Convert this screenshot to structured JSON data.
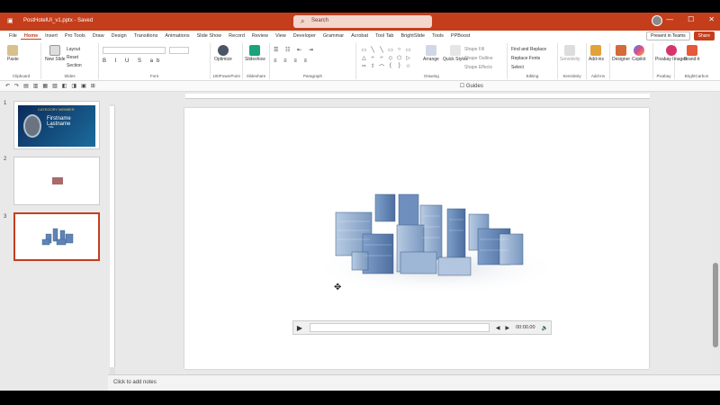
{
  "titlebar": {
    "doc_title": "PostHotelUI_v1.pptx - Saved",
    "search_placeholder": "Search",
    "window_controls": [
      "—",
      "☐",
      "✕"
    ]
  },
  "tabs": [
    "File",
    "Home",
    "Insert",
    "Pro Tools",
    "Draw",
    "Design",
    "Transitions",
    "Animations",
    "Slide Show",
    "Record",
    "Review",
    "View",
    "Developer",
    "Grammar",
    "Acrobat",
    "Tool Tab",
    "BrightSlide",
    "Tools",
    "PPBoost"
  ],
  "tabs_active": "Home",
  "tab_right": {
    "present": "Present in Teams",
    "share": "Share"
  },
  "ribbon": {
    "clipboard": {
      "paste": "Paste",
      "label": "Clipboard"
    },
    "slides": {
      "new_slide": "New Slide",
      "layout": "Layout",
      "reset": "Reset",
      "section": "Section",
      "label": "Slides"
    },
    "font": {
      "label": "Font"
    },
    "ppowerpoint": {
      "optimize": "Optimize",
      "label": "100PowerPoint"
    },
    "slideshare": {
      "button": "Slideshow",
      "label": "Slideshare"
    },
    "paragraph": {
      "label": "Paragraph"
    },
    "drawing": {
      "arrange": "Arrange",
      "quick_styles": "Quick Styles",
      "shape_fill": "Shape Fill",
      "shape_outline": "Shape Outline",
      "shape_effects": "Shape Effects",
      "label": "Drawing"
    },
    "editing": {
      "find_replace": "Find and Replace",
      "replace_fonts": "Replace Fonts",
      "select": "Select",
      "label": "Editing"
    },
    "sensitivity": {
      "button": "Sensitivity",
      "label": "Sensitivity"
    },
    "addins": {
      "button": "Add-ins",
      "label": "Add-ins"
    },
    "designer": {
      "button": "Designer"
    },
    "copilot": {
      "button": "Copilot"
    },
    "pixabay": {
      "button": "Pixabay Images",
      "label": "Pixabay"
    },
    "brightcarbon": {
      "button": "Brand-it",
      "label": "BrightCarbon"
    }
  },
  "toolbar2": {
    "guides_label": "Guides"
  },
  "thumbnails": [
    {
      "num": "1",
      "title_small": "CATEGORY MEMBER",
      "title_big": "Firstname Lastname",
      "subtitle": "Title"
    },
    {
      "num": "2"
    },
    {
      "num": "3"
    }
  ],
  "video": {
    "time": "00:00.00"
  },
  "notes": {
    "placeholder": "Click to add notes"
  },
  "colors": {
    "accent": "#c43e1c",
    "selected_border": "#c43e1c"
  }
}
